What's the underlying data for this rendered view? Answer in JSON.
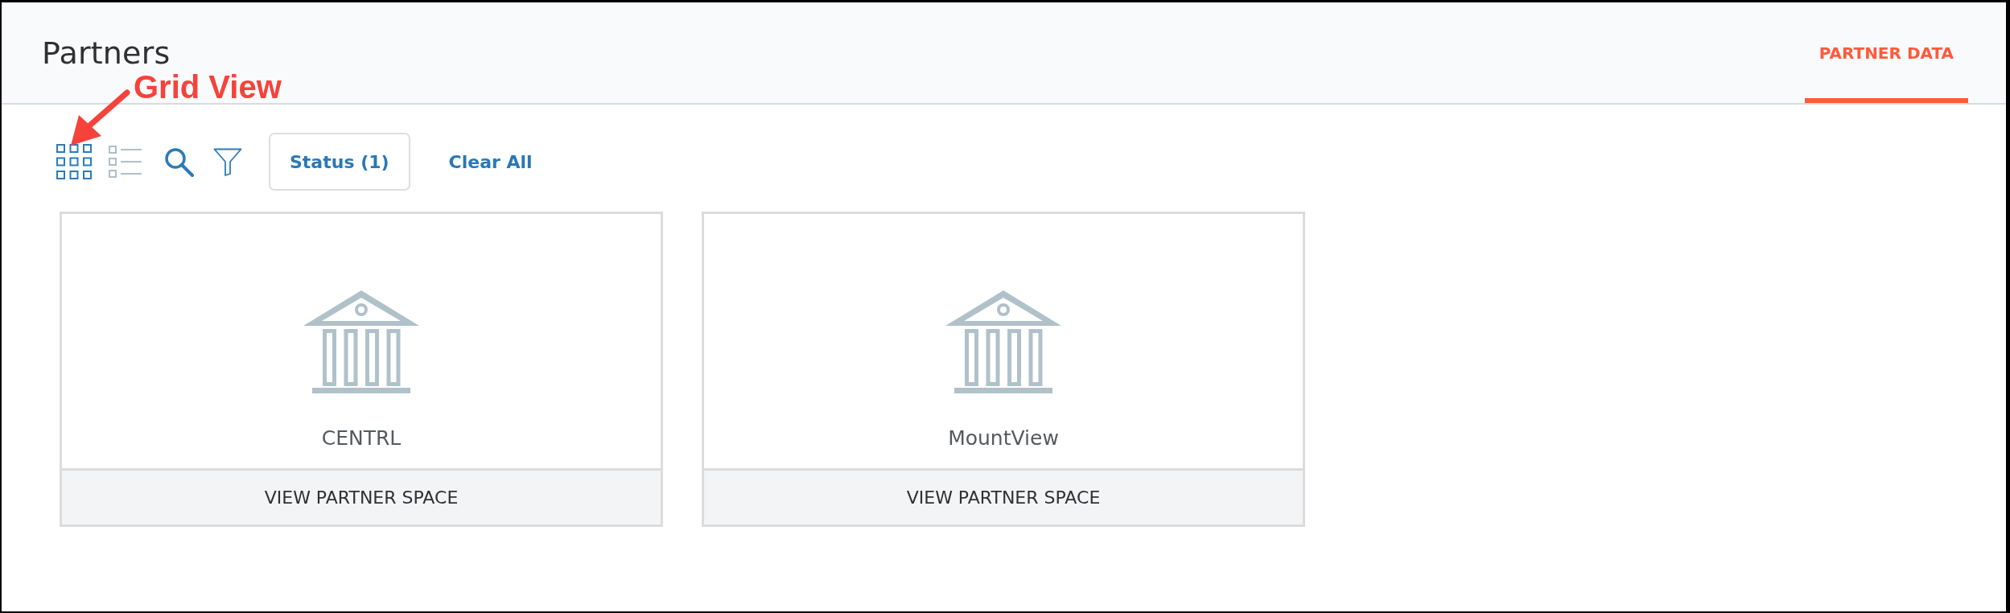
{
  "header": {
    "title": "Partners",
    "tabs": [
      {
        "label": "PARTNER DATA",
        "selected": true
      }
    ]
  },
  "annotation": {
    "text": "Grid View"
  },
  "toolbar": {
    "view_toggles": [
      {
        "kind": "grid",
        "selected": true
      },
      {
        "kind": "list",
        "selected": false
      }
    ],
    "filter_chips": [
      {
        "label": "Status (1)"
      }
    ],
    "clear_link": "Clear All"
  },
  "partners": [
    {
      "name": "CENTRL",
      "action": "VIEW PARTNER SPACE"
    },
    {
      "name": "MountView",
      "action": "VIEW PARTNER SPACE"
    }
  ]
}
